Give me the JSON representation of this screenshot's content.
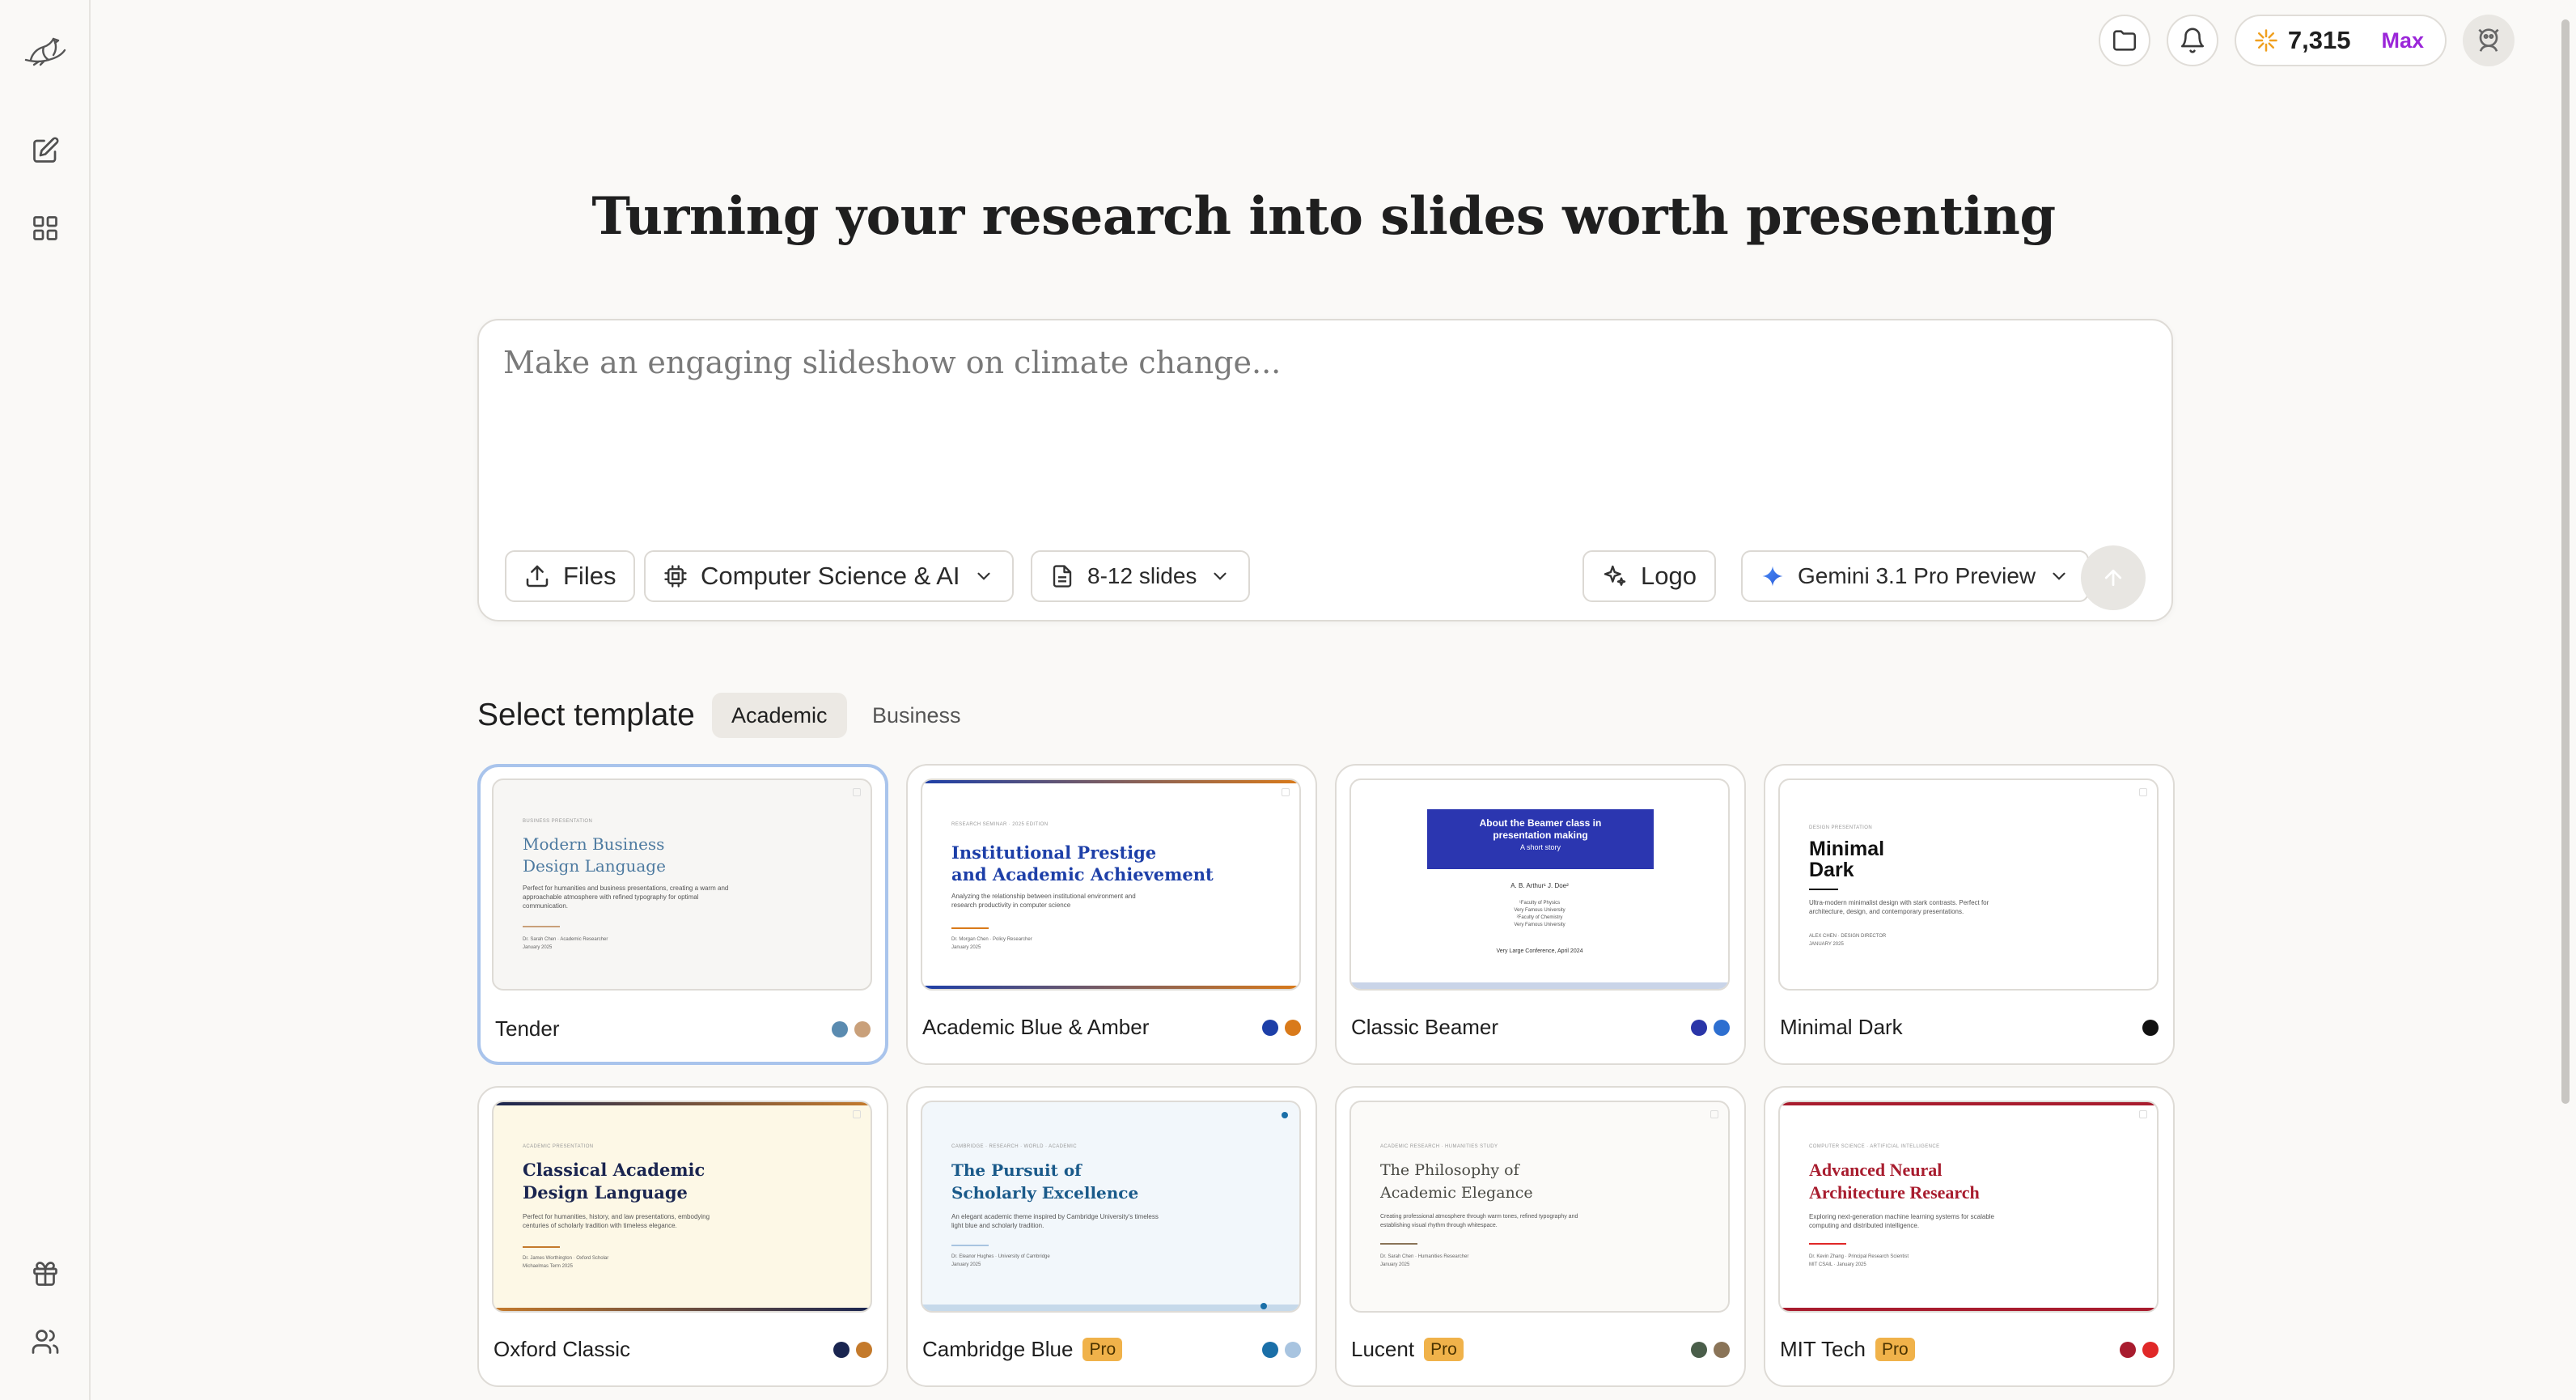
{
  "sidebar": {
    "logo_icon": "bird-logo-icon",
    "items": [
      {
        "icon": "edit-icon"
      },
      {
        "icon": "grid-icon"
      },
      {
        "icon": "gift-icon"
      },
      {
        "icon": "users-icon"
      }
    ]
  },
  "topbar": {
    "credits": "7,315",
    "plan": "Max"
  },
  "hero": {
    "title": "Turning your research into slides worth presenting"
  },
  "prompt": {
    "placeholder": "Make an engaging slideshow on climate change...",
    "files_label": "Files",
    "category_label": "Computer Science & AI",
    "slides_label": "8-12 slides",
    "logo_label": "Logo",
    "model_label": "Gemini 3.1 Pro Preview"
  },
  "templates": {
    "title": "Select template",
    "tabs": [
      "Academic",
      "Business"
    ],
    "cards": [
      {
        "name": "Tender",
        "colors": [
          "#5a8bb0",
          "#c9a07a"
        ],
        "thumb": {
          "kicker": "BUSINESS PRESENTATION",
          "title1": "Modern Business",
          "title2": "Design Language",
          "body": "Perfect for humanities and business presentations, creating a warm and approachable atmosphere with refined typography for optimal communication.",
          "foot1": "Dr. Sarah Chen · Academic Researcher",
          "foot2": "January 2025"
        }
      },
      {
        "name": "Academic Blue & Amber",
        "colors": [
          "#1d3fa8",
          "#d97a1a"
        ],
        "thumb": {
          "kicker": "RESEARCH SEMINAR · 2025 EDITION",
          "title1": "Institutional Prestige",
          "title2": "and Academic Achievement",
          "body": "Analyzing the relationship between institutional environment and research productivity in computer science",
          "foot1": "Dr. Morgan Chen · Policy Researcher",
          "foot2": "January 2025"
        }
      },
      {
        "name": "Classic Beamer",
        "colors": [
          "#2a35a8",
          "#2e6fd0"
        ],
        "thumb": {
          "title1": "About the Beamer class in",
          "title2": "presentation making",
          "subtitle": "A short story",
          "authors": "A. B. Arthur¹  J. Doe²",
          "aff1": "¹Faculty of Physics",
          "aff2": "Very Famous University",
          "aff3": "²Faculty of Chemistry",
          "aff4": "Very Famous University",
          "conf": "Very Large Conference, April 2024"
        }
      },
      {
        "name": "Minimal Dark",
        "colors": [
          "#111111"
        ],
        "thumb": {
          "kicker": "DESIGN PRESENTATION",
          "title1": "Minimal",
          "title2": "Dark",
          "body": "Ultra-modern minimalist design with stark contrasts. Perfect for architecture, design, and contemporary presentations.",
          "foot1": "ALEX CHEN · DESIGN DIRECTOR",
          "foot2": "JANUARY 2025"
        }
      },
      {
        "name": "Oxford Classic",
        "colors": [
          "#1a2550",
          "#c47a2c"
        ],
        "pro": false,
        "thumb": {
          "kicker": "ACADEMIC PRESENTATION",
          "title1": "Classical Academic",
          "title2": "Design Language",
          "body": "Perfect for humanities, history, and law presentations, embodying centuries of scholarly tradition with timeless elegance.",
          "foot1": "Dr. James Worthington · Oxford Scholar",
          "foot2": "Michaelmas Term 2025"
        }
      },
      {
        "name": "Cambridge Blue",
        "pro": "Pro",
        "colors": [
          "#1a6fa8",
          "#a8c4e0"
        ],
        "thumb": {
          "kicker": "CAMBRIDGE · RESEARCH · WORLD · ACADEMIC",
          "title1": "The Pursuit of",
          "title2": "Scholarly Excellence",
          "body": "An elegant academic theme inspired by Cambridge University's timeless light blue and scholarly tradition.",
          "foot1": "Dr. Eleanor Hughes · University of Cambridge",
          "foot2": "January 2025"
        }
      },
      {
        "name": "Lucent",
        "pro": "Pro",
        "colors": [
          "#4a5e4a",
          "#8a7458"
        ],
        "thumb": {
          "kicker": "ACADEMIC RESEARCH · HUMANITIES STUDY",
          "title1": "The Philosophy of",
          "title2": "Academic Elegance",
          "body": "Creating professional atmosphere through warm tones, refined typography and establishing visual rhythm through whitespace.",
          "foot1": "Dr. Sarah Chen · Humanities Researcher",
          "foot2": "January 2025"
        }
      },
      {
        "name": "MIT Tech",
        "pro": "Pro",
        "colors": [
          "#a81c2e",
          "#e02828"
        ],
        "thumb": {
          "kicker": "COMPUTER SCIENCE · ARTIFICIAL INTELLIGENCE",
          "title1": "Advanced Neural",
          "title2": "Architecture Research",
          "body": "Exploring next-generation machine learning systems for scalable computing and distributed intelligence.",
          "foot1": "Dr. Kevin Zhang · Principal Research Scientist",
          "foot2": "MIT CSAIL · January 2025"
        }
      }
    ]
  }
}
